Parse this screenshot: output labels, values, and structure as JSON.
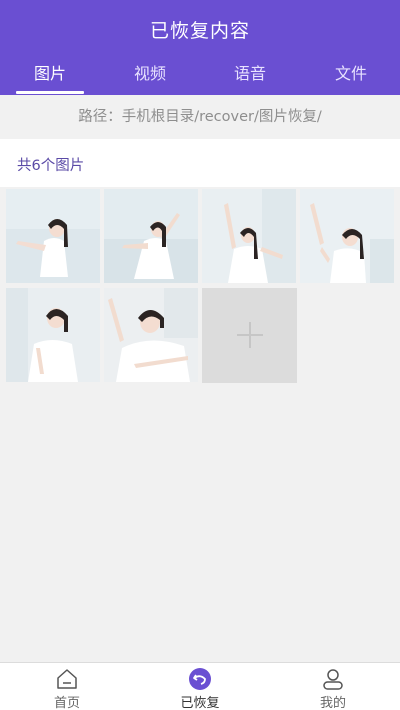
{
  "header": {
    "title": "已恢复内容"
  },
  "tabs": [
    {
      "label": "图片",
      "active": true
    },
    {
      "label": "视频",
      "active": false
    },
    {
      "label": "语音",
      "active": false
    },
    {
      "label": "文件",
      "active": false
    }
  ],
  "path": {
    "text": "路径：手机根目录/recover/图片恢复/"
  },
  "gallery": {
    "count_text": "共6个图片",
    "images": [
      {
        "icon": "photo-thumbnail"
      },
      {
        "icon": "photo-thumbnail"
      },
      {
        "icon": "photo-thumbnail"
      },
      {
        "icon": "photo-thumbnail"
      },
      {
        "icon": "photo-thumbnail"
      },
      {
        "icon": "photo-thumbnail"
      }
    ],
    "add_icon": "plus-icon"
  },
  "bottom_nav": [
    {
      "label": "首页",
      "icon": "home-icon",
      "active": false
    },
    {
      "label": "已恢复",
      "icon": "restore-icon",
      "active": true
    },
    {
      "label": "我的",
      "icon": "user-icon",
      "active": false
    }
  ],
  "colors": {
    "accent": "#6a4fd2",
    "background": "#f1f1f1"
  }
}
